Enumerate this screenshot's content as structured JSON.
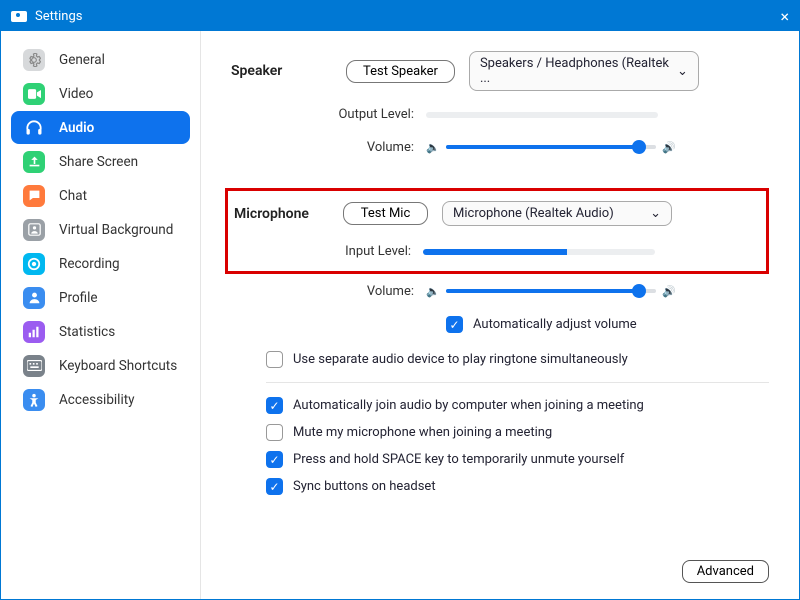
{
  "window": {
    "title": "Settings"
  },
  "sidebar": {
    "items": [
      {
        "label": "General",
        "icon": "gear",
        "color": "#d7d9db"
      },
      {
        "label": "Video",
        "icon": "video",
        "color": "#2fd175"
      },
      {
        "label": "Audio",
        "icon": "headphones",
        "color": "#ffffff",
        "active": true
      },
      {
        "label": "Share Screen",
        "icon": "share",
        "color": "#2fd175"
      },
      {
        "label": "Chat",
        "icon": "chat",
        "color": "#ff7a3c"
      },
      {
        "label": "Virtual Background",
        "icon": "virtual-bg",
        "color": "#9aa0a6"
      },
      {
        "label": "Recording",
        "icon": "recording",
        "color": "#00b8f0"
      },
      {
        "label": "Profile",
        "icon": "profile",
        "color": "#3a8df0"
      },
      {
        "label": "Statistics",
        "icon": "statistics",
        "color": "#9b5cf0"
      },
      {
        "label": "Keyboard Shortcuts",
        "icon": "keyboard",
        "color": "#7a828a"
      },
      {
        "label": "Accessibility",
        "icon": "accessibility",
        "color": "#3a8df0"
      }
    ]
  },
  "audio": {
    "speaker": {
      "heading": "Speaker",
      "test_label": "Test Speaker",
      "device": "Speakers / Headphones (Realtek ...",
      "output_level_label": "Output Level:",
      "output_level_pct": 0,
      "volume_label": "Volume:",
      "volume_pct": 92
    },
    "microphone": {
      "heading": "Microphone",
      "test_label": "Test Mic",
      "device": "Microphone (Realtek Audio)",
      "input_level_label": "Input Level:",
      "input_level_pct": 62,
      "volume_label": "Volume:",
      "volume_pct": 92,
      "auto_adjust_label": "Automatically adjust volume",
      "auto_adjust_checked": true
    },
    "options": {
      "separate_ringtone": {
        "label": "Use separate audio device to play ringtone simultaneously",
        "checked": false
      },
      "auto_join": {
        "label": "Automatically join audio by computer when joining a meeting",
        "checked": true
      },
      "mute_on_join": {
        "label": "Mute my microphone when joining a meeting",
        "checked": false
      },
      "space_unmute": {
        "label": "Press and hold SPACE key to temporarily unmute yourself",
        "checked": true
      },
      "sync_headset": {
        "label": "Sync buttons on headset",
        "checked": true
      }
    },
    "advanced_label": "Advanced"
  }
}
